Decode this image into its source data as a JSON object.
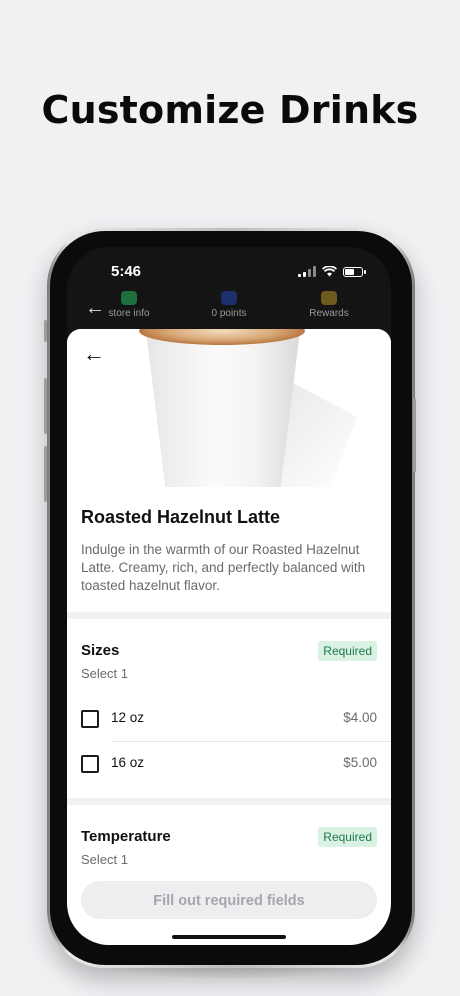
{
  "headline": "Customize Drinks",
  "status_bar": {
    "time": "5:46"
  },
  "top_nav": {
    "items": [
      {
        "label": "store info",
        "icon": "cup-icon",
        "color": "#1f6f3a"
      },
      {
        "label": "0 points",
        "icon": "cart-icon",
        "color": "#1e2f6e"
      },
      {
        "label": "Rewards",
        "icon": "trophy-icon",
        "color": "#6e5a1f"
      }
    ]
  },
  "product": {
    "name": "Roasted Hazelnut Latte",
    "description": "Indulge in the warmth of our Roasted Hazelnut Latte. Creamy, rich, and perfectly balanced with toasted hazelnut flavor."
  },
  "sizes": {
    "title": "Sizes",
    "subtitle": "Select 1",
    "badge": "Required",
    "options": [
      {
        "label": "12 oz",
        "price": "$4.00"
      },
      {
        "label": "16 oz",
        "price": "$5.00"
      }
    ]
  },
  "temperature": {
    "title": "Temperature",
    "subtitle": "Select 1",
    "badge": "Required"
  },
  "cta": {
    "label": "Fill out required fields"
  },
  "colors": {
    "badge_bg": "#daf2e3",
    "badge_text": "#1c7a45",
    "background": "#f1f1f4"
  }
}
